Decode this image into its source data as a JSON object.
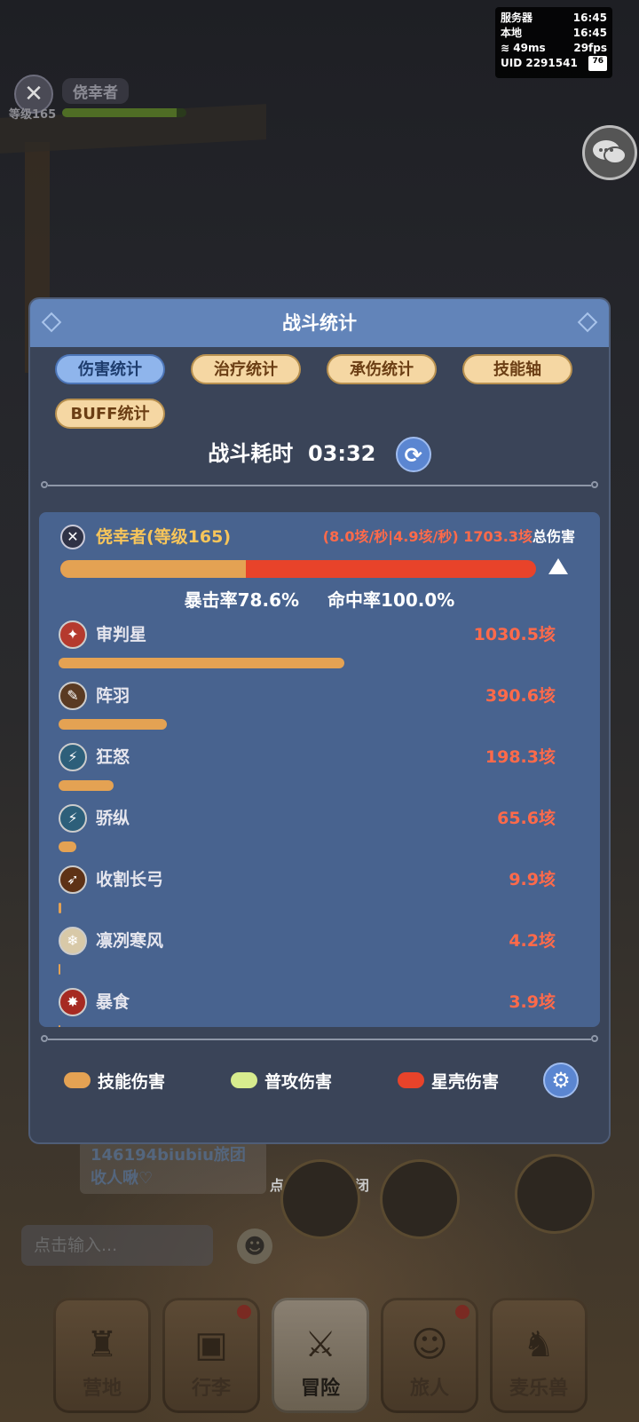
{
  "status": {
    "server_label": "服务器",
    "server_time": "16:45",
    "local_label": "本地",
    "local_time": "16:45",
    "ping": "49ms",
    "fps": "29fps",
    "uid": "UID 2291541",
    "battery": "76"
  },
  "player": {
    "name": "侥幸者",
    "level": "等级165",
    "hp_fraction": 0.92
  },
  "dialog": {
    "title": "战斗统计",
    "tabs": [
      "伤害统计",
      "治疗统计",
      "承伤统计",
      "技能轴",
      "BUFF统计"
    ],
    "active_tab": "伤害统计",
    "battle_time_label": "战斗耗时",
    "battle_time": "03:32",
    "hero": {
      "name": "侥幸者(等级165)",
      "dps": "(8.0垓/秒|4.9垓/秒)",
      "total": "1703.3垓",
      "total_label": "总伤害",
      "skill_fraction": 0.39
    },
    "crit_rate": "暴击率78.6%",
    "hit_rate": "命中率100.0%",
    "skills": [
      {
        "name": "审判星",
        "value": "1030.5垓",
        "amount": 1030.5,
        "icon": "judgment-star-icon",
        "color": "#b53a2e"
      },
      {
        "name": "阵羽",
        "value": "390.6垓",
        "amount": 390.6,
        "icon": "feather-icon",
        "color": "#5a3a22"
      },
      {
        "name": "狂怒",
        "value": "198.3垓",
        "amount": 198.3,
        "icon": "fury-icon",
        "color": "#2d5f7a"
      },
      {
        "name": "骄纵",
        "value": "65.6垓",
        "amount": 65.6,
        "icon": "arrogance-icon",
        "color": "#2d5f7a"
      },
      {
        "name": "收割长弓",
        "value": "9.9垓",
        "amount": 9.9,
        "icon": "longbow-icon",
        "color": "#5e3216"
      },
      {
        "name": "凛冽寒风",
        "value": "4.2垓",
        "amount": 4.2,
        "icon": "cold-wind-icon",
        "color": "#d8c9a8"
      },
      {
        "name": "暴食",
        "value": "3.9垓",
        "amount": 3.9,
        "icon": "gluttony-icon",
        "color": "#a62a22"
      }
    ],
    "legend": [
      {
        "label": "技能伤害",
        "color": "#e4a253"
      },
      {
        "label": "普攻伤害",
        "color": "#d7ec8e"
      },
      {
        "label": "星壳伤害",
        "color": "#e8432a"
      }
    ]
  },
  "chat": {
    "message": "146194biubiu旅团收人啾♡",
    "input_placeholder": "点击输入..."
  },
  "close_hint": "点击空白处关闭",
  "nav": [
    {
      "label": "营地",
      "icon": "castle-icon",
      "badge": false
    },
    {
      "label": "行李",
      "icon": "chest-icon",
      "badge": true
    },
    {
      "label": "冒险",
      "icon": "crossed-swords-icon",
      "badge": false,
      "active": true
    },
    {
      "label": "旅人",
      "icon": "traveler-icon",
      "badge": true
    },
    {
      "label": "麦乐兽",
      "icon": "pet-icon",
      "badge": false
    }
  ]
}
